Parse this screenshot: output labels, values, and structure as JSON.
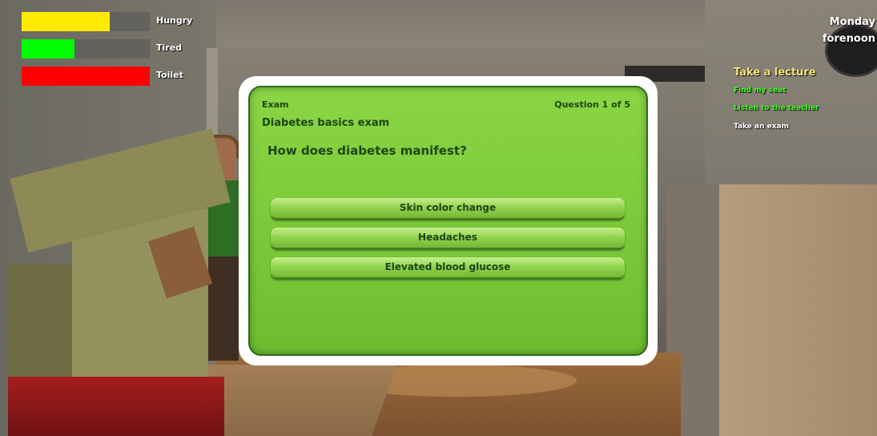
{
  "hud": {
    "needs": [
      {
        "label": "Hungry",
        "level": 0.69,
        "color": "#ffea00"
      },
      {
        "label": "Tired",
        "level": 0.41,
        "color": "#00ff00"
      },
      {
        "label": "Toilet",
        "level": 1.0,
        "color": "#ff0000"
      }
    ],
    "time": {
      "day": "Monday",
      "part": "forenoon"
    },
    "quest": {
      "title": "Take a lecture",
      "title_color": "#f3e27a",
      "tasks": [
        {
          "label": "Find my seat",
          "color": "#3cff1e"
        },
        {
          "label": "Listen to the teacher",
          "color": "#3cff1e"
        },
        {
          "label": "Take an exam",
          "color": "#ffffff"
        }
      ]
    }
  },
  "exam": {
    "kind": "Exam",
    "counter": "Question 1 of 5",
    "name": "Diabetes basics exam",
    "question": "How does diabetes manifest?",
    "answers": [
      "Skin color change",
      "Headaches",
      "Elevated blood glucose"
    ],
    "panel_color": "#7bc93a",
    "text_color": "#1f4614"
  },
  "icons": {
    "clock": "wall-clock-icon"
  }
}
